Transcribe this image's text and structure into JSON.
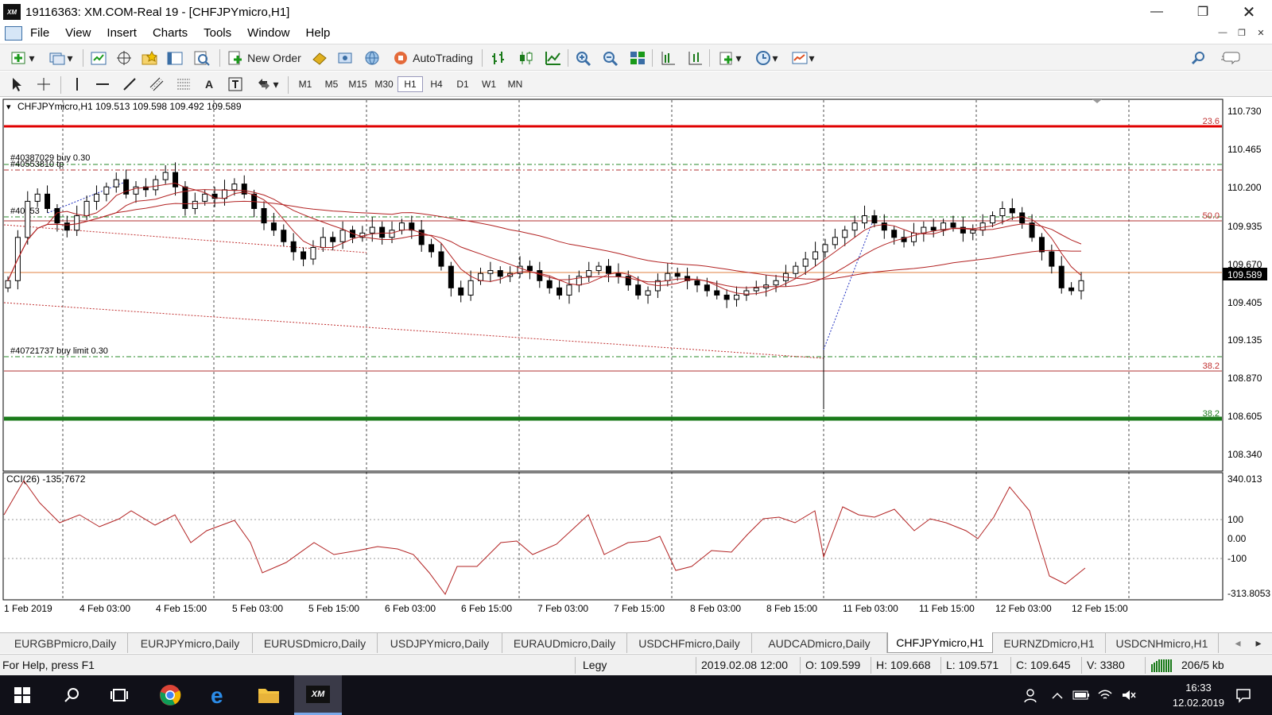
{
  "window": {
    "title": "19116363: XM.COM-Real 19 - [CHFJPYmicro,H1]",
    "logo_text": "XM",
    "minimize_icon": "minimize-icon",
    "maximize_icon": "maximize-icon",
    "close_icon": "close-icon"
  },
  "menu": {
    "items": [
      "File",
      "View",
      "Insert",
      "Charts",
      "Tools",
      "Window",
      "Help"
    ]
  },
  "toolbar": {
    "new_order_label": "New Order",
    "autotrading_label": "AutoTrading"
  },
  "timeframes": {
    "items": [
      "M1",
      "M5",
      "M15",
      "M30",
      "H1",
      "H4",
      "D1",
      "W1",
      "MN"
    ],
    "active": "H1"
  },
  "chart": {
    "header": "CHFJPYmicro,H1  109.513 109.598 109.492 109.589",
    "current_price_label": "109.589",
    "price_ticks": [
      "110.730",
      "110.465",
      "110.200",
      "109.935",
      "109.670",
      "109.405",
      "109.135",
      "108.870",
      "108.605",
      "108.340"
    ],
    "level_labels": [
      "23.6",
      "50.0",
      "38.2",
      "38.2"
    ],
    "order_labels": [
      "#40387029 buy 0.30",
      "#40553810 tp",
      "#40553",
      "#40721737 buy limit 0.30"
    ],
    "time_ticks": [
      "1 Feb 2019",
      "4 Feb 03:00",
      "4 Feb 15:00",
      "5 Feb 03:00",
      "5 Feb 15:00",
      "6 Feb 03:00",
      "6 Feb 15:00",
      "7 Feb 03:00",
      "7 Feb 15:00",
      "8 Feb 03:00",
      "8 Feb 15:00",
      "11 Feb 03:00",
      "11 Feb 15:00",
      "12 Feb 03:00",
      "12 Feb 15:00"
    ],
    "colors": {
      "bull": "#ffffff",
      "bear": "#000000",
      "ma": "#b22222",
      "red_level": "#e00000",
      "green_level": "#0a8a0a",
      "cci": "#b22222"
    }
  },
  "indicator": {
    "header": "CCI(26) -135.7672",
    "ticks": [
      "340.013",
      "100",
      "0.00",
      "-100",
      "-313.8053"
    ]
  },
  "chart_data": {
    "type": "candlestick",
    "symbol": "CHFJPYmicro",
    "timeframe": "H1",
    "ylim": [
      108.34,
      110.73
    ],
    "closes": [
      109.55,
      109.85,
      110.1,
      110.15,
      110.05,
      109.95,
      109.9,
      110.0,
      110.1,
      110.15,
      110.2,
      110.25,
      110.15,
      110.2,
      110.18,
      110.25,
      110.3,
      110.2,
      110.05,
      110.1,
      110.15,
      110.12,
      110.18,
      110.22,
      110.15,
      110.05,
      109.95,
      109.9,
      109.82,
      109.75,
      109.7,
      109.78,
      109.85,
      109.82,
      109.9,
      109.85,
      109.88,
      109.92,
      109.85,
      109.9,
      109.95,
      109.9,
      109.8,
      109.75,
      109.65,
      109.5,
      109.45,
      109.55,
      109.6,
      109.62,
      109.58,
      109.6,
      109.65,
      109.62,
      109.55,
      109.5,
      109.45,
      109.52,
      109.58,
      109.62,
      109.65,
      109.6,
      109.58,
      109.52,
      109.45,
      109.48,
      109.55,
      109.6,
      109.58,
      109.55,
      109.52,
      109.48,
      109.45,
      109.42,
      109.45,
      109.48,
      109.5,
      109.52,
      109.55,
      109.6,
      109.65,
      109.7,
      109.75,
      109.8,
      109.85,
      109.9,
      109.95,
      110.0,
      109.95,
      109.9,
      109.85,
      109.82,
      109.88,
      109.92,
      109.9,
      109.95,
      109.92,
      109.88,
      109.9,
      109.95,
      110.0,
      110.05,
      110.02,
      109.95,
      109.85,
      109.75,
      109.65,
      109.5,
      109.48,
      109.55
    ]
  },
  "tabs": {
    "items": [
      "EURGBPmicro,Daily",
      "EURJPYmicro,Daily",
      "EURUSDmicro,Daily",
      "USDJPYmicro,Daily",
      "EURAUDmicro,Daily",
      "USDCHFmicro,Daily",
      "AUDCADmicro,Daily",
      "CHFJPYmicro,H1",
      "EURNZDmicro,H1",
      "USDCNHmicro,H1"
    ],
    "active": "CHFJPYmicro,H1"
  },
  "status": {
    "help": "For Help, press F1",
    "profile": "Legy",
    "datetime": "2019.02.08 12:00",
    "open": "O: 109.599",
    "high": "H: 109.668",
    "low": "L: 109.571",
    "close": "C: 109.645",
    "volume": "V: 3380",
    "traffic": "206/5 kb"
  },
  "taskbar": {
    "time": "16:33",
    "date": "12.02.2019",
    "xm_label": "XM"
  }
}
